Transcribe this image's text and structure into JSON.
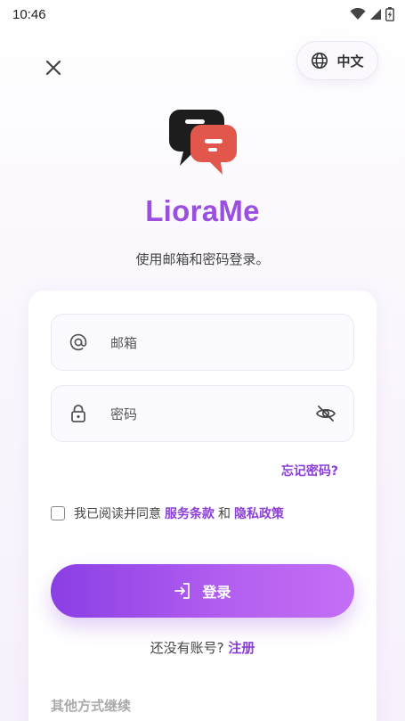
{
  "status_bar": {
    "time": "10:46"
  },
  "header": {
    "language_label": "中文"
  },
  "app": {
    "name": "LioraMe",
    "subtitle": "使用邮箱和密码登录。"
  },
  "form": {
    "email_placeholder": "邮箱",
    "password_placeholder": "密码",
    "forgot_label": "忘记密码?",
    "agree_prefix": "我已阅读并同意",
    "terms_label": "服务条款",
    "and_label": "和",
    "privacy_label": "隐私政策",
    "login_label": "登录"
  },
  "footer": {
    "no_account_label": "还没有账号?",
    "register_label": "注册",
    "other_methods_label": "其他方式继续"
  },
  "colors": {
    "accent": "#8b3fd6",
    "button_start": "#8a3fe4",
    "button_end": "#c36ff5",
    "logo_dark": "#1d1d1d",
    "logo_red": "#e2574c"
  },
  "icons": {
    "wifi": "wifi-icon",
    "signal": "signal-icon",
    "battery": "battery-icon",
    "close": "close-icon",
    "globe": "globe-icon",
    "at": "at-icon",
    "lock": "lock-icon",
    "eye_off": "eye-off-icon",
    "login": "login-icon"
  }
}
